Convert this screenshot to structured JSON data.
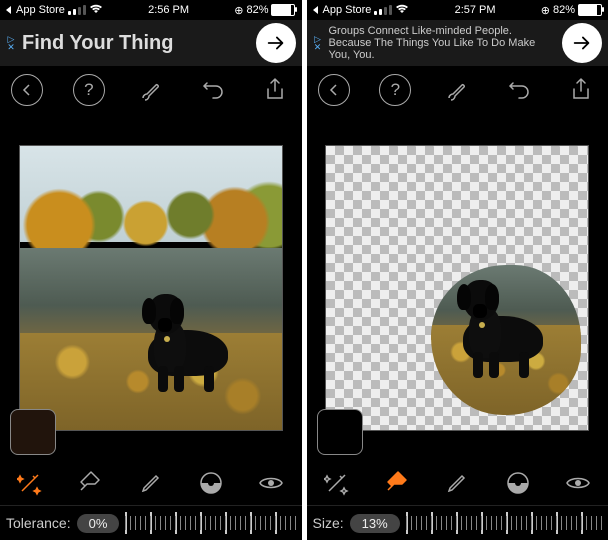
{
  "status_bar": {
    "back_label": "App Store",
    "battery_pct": "82%",
    "left": {
      "time": "2:56 PM"
    },
    "right": {
      "time": "2:57 PM"
    }
  },
  "ad": {
    "left": {
      "text": "Find Your Thing"
    },
    "right": {
      "text": "Groups Connect Like-minded People. Because The Things You Like To Do Make You, You."
    }
  },
  "toolbar": {
    "back": "‹",
    "help": "?",
    "brush": "brush-icon",
    "undo": "undo-icon",
    "share": "share-icon"
  },
  "tools": {
    "wand": "magic-wand-icon",
    "eraser": "eraser-icon",
    "pen": "pen-icon",
    "mask": "mask-circle-icon",
    "eye": "eye-icon"
  },
  "slider": {
    "left": {
      "label": "Tolerance:",
      "value": "0%"
    },
    "right": {
      "label": "Size:",
      "value": "13%"
    }
  }
}
